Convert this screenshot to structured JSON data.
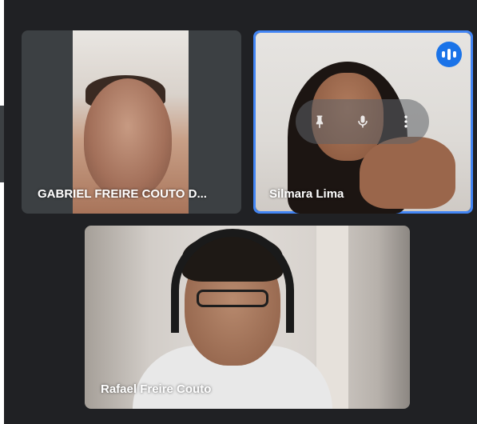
{
  "participants": [
    {
      "name": "GABRIEL FREIRE COUTO D..."
    },
    {
      "name": "Silmara Lima",
      "speaking": true,
      "controls": [
        "pin-icon",
        "mic-icon",
        "more-options-icon"
      ]
    },
    {
      "name": "Rafael Freire Couto"
    }
  ],
  "colors": {
    "background": "#202124",
    "tile": "#3c4043",
    "active_border": "#4285f4",
    "speaking_indicator": "#1a73e8"
  }
}
